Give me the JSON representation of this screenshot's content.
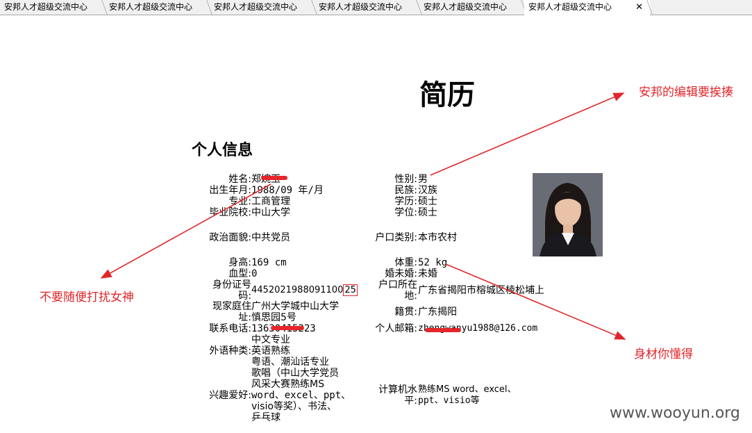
{
  "tabs": [
    {
      "label": "安邦人才超级交流中心"
    },
    {
      "label": "安邦人才超级交流中心"
    },
    {
      "label": "安邦人才超级交流中心"
    },
    {
      "label": "安邦人才超级交流中心"
    },
    {
      "label": "安邦人才超级交流中心"
    },
    {
      "label": "安邦人才超级交流中心",
      "active": true
    }
  ],
  "tab_close": "✕",
  "resume": {
    "title": "简历",
    "section": "个人信息",
    "fields": {
      "name_label": "姓名:",
      "name_value": "郑婉玉",
      "gender_label": "性别:",
      "gender_value": "男",
      "birth_label": "出生年月:",
      "birth_value": "1988/09 年/月",
      "ethnic_label": "民族:",
      "ethnic_value": "汉族",
      "major_label": "专业:",
      "major_value": "工商管理",
      "edu_label": "学历:",
      "edu_value": "硕士",
      "school_label": "毕业院校:",
      "school_value": "中山大学",
      "degree_label": "学位:",
      "degree_value": "硕士",
      "political_label": "政治面貌:",
      "political_value": "中共党员",
      "hukou_type_label": "户口类别:",
      "hukou_type_value": "本市农村",
      "height_label": "身高:",
      "height_value": "169 cm",
      "weight_label": "体重:",
      "weight_value": "52 kg",
      "blood_label": "血型:",
      "blood_value": "0",
      "marital_label": "婚未婚:",
      "marital_value": "未婚",
      "id_label_1": "身份证号",
      "id_label_2": "码:",
      "id_value": "4452021988091100",
      "id_value_boxed": "25",
      "hukou_loc_label_1": "户口所在",
      "hukou_loc_label_2": "地:",
      "hukou_loc_value": "广东省揭阳市榕城区棱松埔上",
      "address_label_1": "现家庭住",
      "address_label_2": "址:",
      "address_value_1": "广州大学城中山大学",
      "address_value_2": "慎思园5号",
      "native_label": "籍贯:",
      "native_value": "广东揭阳",
      "phone_label": "联系电话:",
      "phone_value": "13630415223",
      "email_label": "个人邮箱:",
      "email_value": "zhengwanyu1988@126.com",
      "lang_label": "外语种类:",
      "lang_value_1": "中文专业",
      "lang_value_2": "英语熟练",
      "lang_value_3": "粤语、潮汕话专业",
      "hobby_label": "兴趣爱好:",
      "hobby_value_1": "歌唱（中山大学党员",
      "hobby_value_2": "风采大赛熟练MS",
      "hobby_value_3": "word、excel、ppt、",
      "hobby_value_4": "visio等奖）、书法、",
      "hobby_value_5": "乒乓球",
      "computer_label_1": "计算机水",
      "computer_label_2": "平:",
      "computer_value_1": "熟练MS word、excel、",
      "computer_value_2": "ppt、visio等"
    }
  },
  "annotations": {
    "top_right": "安邦的编辑要挨揍",
    "left": "不要随便打扰女神",
    "bottom_right": "身材你懂得"
  },
  "watermark": "www.wooyun.org",
  "colors": {
    "annotation": "#e0262a",
    "redact": "#e5262a"
  }
}
